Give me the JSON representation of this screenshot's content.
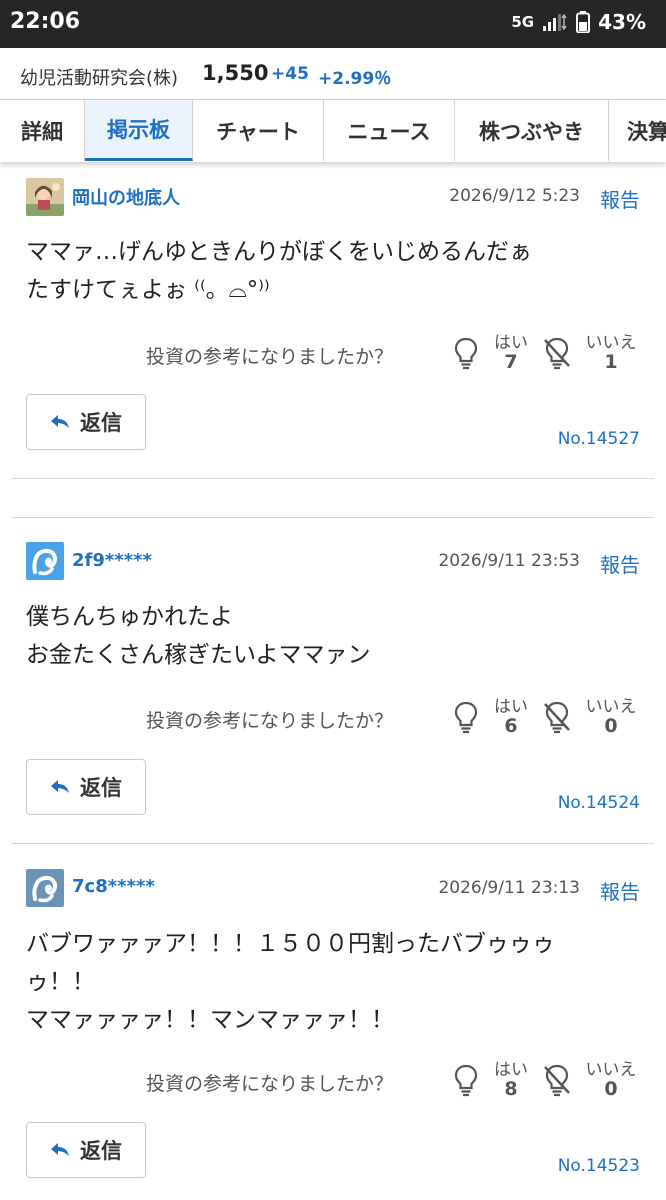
{
  "status_bar": {
    "time": "22:06",
    "network": "5G",
    "battery": "43%"
  },
  "stock": {
    "name": "幼児活動研究会(株)",
    "price": "1,550",
    "change": "+45",
    "change_pct": "+2.99％"
  },
  "tabs": [
    {
      "label": "詳細"
    },
    {
      "label": "掲示板",
      "active": true
    },
    {
      "label": "チャート"
    },
    {
      "label": "ニュース"
    },
    {
      "label": "株つぶやき"
    },
    {
      "label": "決算"
    }
  ],
  "posts": [
    {
      "author": "岡山の地底人",
      "date": "2026/9/12 5:23",
      "report_label": "報告",
      "body": "ママァ…げんゆときんりがぼくをいじめるんだぁ\nたすけてぇよぉ ⁽⁽。⌓°⁾⁾",
      "question": "投資の参考になりましたか？",
      "yes_label": "はい",
      "yes_count": "7",
      "no_label": "いいえ",
      "no_count": "1",
      "reply_label": "返信",
      "number": "No.14527"
    },
    {
      "author": "2f9*****",
      "date": "2026/9/11 23:53",
      "report_label": "報告",
      "body": "僕ちんちゅかれたよ\nお金たくさん稼ぎたいよママァン",
      "question": "投資の参考になりましたか？",
      "yes_label": "はい",
      "yes_count": "6",
      "no_label": "いいえ",
      "no_count": "0",
      "reply_label": "返信",
      "number": "No.14524"
    },
    {
      "author": "7c8*****",
      "date": "2026/9/11 23:13",
      "report_label": "報告",
      "body": "バブワァァァア！！！１５００円割ったバブゥゥゥ\nゥ！！\nママァァァァ！！マンマァァァ！！",
      "question": "投資の参考になりましたか？",
      "yes_label": "はい",
      "yes_count": "8",
      "no_label": "いいえ",
      "no_count": "0",
      "reply_label": "返信",
      "number": "No.14523"
    }
  ],
  "icons": {
    "helpful": "lightbulb-icon",
    "not_helpful": "lightbulb-off-icon",
    "reply": "reply-arrow-icon",
    "avatar_default": "default-user-avatar"
  },
  "colors": {
    "accent": "#1f6fc2",
    "status_bar": "#262626"
  }
}
